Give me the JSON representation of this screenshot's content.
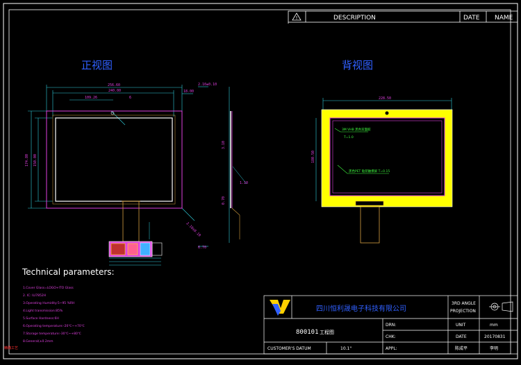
{
  "header": {
    "warn_symbol": "!",
    "description": "DESCRIPTION",
    "date": "DATE",
    "name": "NAME"
  },
  "front_view": {
    "title": "正视图",
    "dims": {
      "d1": "256.60",
      "d2": "240.00",
      "d3": "109.26",
      "d4": "18.00",
      "d5": "6",
      "left1": "174.80",
      "left2": "150.00",
      "right1": "2.10±0.10"
    }
  },
  "back_view": {
    "title": "背视图",
    "dims": {
      "top": "228.50",
      "left": "180.50"
    },
    "note1": "3M VHB 黑色双面胶",
    "note1b": "T=1.0",
    "note2": "黑色PET 贴装触摸屏 T=0.15"
  },
  "tech": {
    "title": "Technical parameters:",
    "items": [
      "1.Cover Glass=LOGO+ITO Glass",
      "2. IC: ILI7852H",
      "3.Operating Humidity:5~95 %RH",
      "4.Light transmission:85%",
      "5.Surface Hardness:6H",
      "6.Operating temperature:-20℃~+70℃",
      "7.Storage temperature:-30℃~+80℃",
      "8.General(±0.2mm"
    ],
    "footer_note": "精确工艺"
  },
  "title_block": {
    "company": "四川恒利晟电子科技有限公司",
    "part": "800101",
    "part_suffix": "工程图",
    "projection": "3RD ANGLE\nPROJECTION",
    "drn": "DRN:",
    "chk": "CHK:",
    "appl": "APPL:",
    "customer": "CUSTOMER'S DATUM",
    "size": "10.1\"",
    "unit_label": "UNIT",
    "unit": "mm",
    "date_label": "DATE",
    "date": "20170831",
    "sign1": "陈成平",
    "sign2": "李明"
  },
  "colors": {
    "frame": "#ffffff",
    "magenta": "#e040e0",
    "cyan": "#30d0e0",
    "yellow": "#ffff00",
    "orange": "#d8a040",
    "blue": "#3050ff",
    "green": "#40ff40",
    "title_blue": "#3060ff"
  }
}
